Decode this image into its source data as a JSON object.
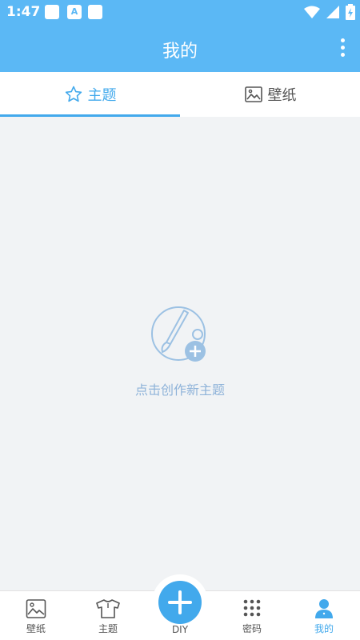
{
  "status": {
    "time": "1:47",
    "app_icon_letter": "A"
  },
  "appbar": {
    "title": "我的"
  },
  "tabs": [
    {
      "label": "主题",
      "icon": "star-icon",
      "active": true
    },
    {
      "label": "壁纸",
      "icon": "image-icon",
      "active": false
    }
  ],
  "empty": {
    "message": "点击创作新主题",
    "icon": "palette-brush-add-icon"
  },
  "bottom_nav": [
    {
      "label": "壁纸",
      "icon": "wallpaper-icon"
    },
    {
      "label": "主题",
      "icon": "tshirt-icon"
    },
    {
      "label": "DIY",
      "icon": "plus-icon"
    },
    {
      "label": "密码",
      "icon": "keypad-icon"
    },
    {
      "label": "我的",
      "icon": "person-icon",
      "active": true
    }
  ],
  "colors": {
    "primary": "#42a9ec",
    "appbar": "#5bb8f5",
    "background": "#f1f3f5"
  }
}
